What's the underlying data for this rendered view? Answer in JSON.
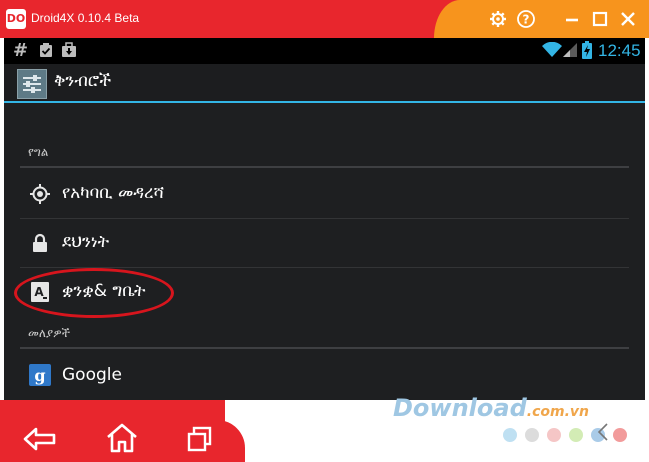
{
  "window": {
    "app_name": "Droid4X 0.10.4 Beta",
    "logo_text": "DO",
    "buttons": [
      "settings-icon",
      "help-icon",
      "minimize-icon",
      "maximize-icon",
      "close-icon"
    ]
  },
  "statusbar": {
    "left_icons": [
      "hash-icon",
      "clipboard-check-icon",
      "bag-download-icon"
    ],
    "right_icons": [
      "wifi-icon",
      "signal-icon",
      "battery-icon"
    ],
    "clock": "12:45"
  },
  "actionbar": {
    "title": "ቅንብሮች"
  },
  "sections": {
    "personal": "የግል",
    "accounts": "መለያዎች"
  },
  "rows": {
    "location": "የአካባቢ መዳረሻ",
    "security": "ደህንነት",
    "language": "ቋንቋ& ግቤት",
    "google": "Google"
  },
  "watermark": {
    "text": "Download",
    "domain": ".com.vn"
  },
  "colors": {
    "titlebar_red": "#e8262d",
    "titlebar_orange": "#f7941d",
    "accent_blue": "#33b5e5",
    "annotation_red": "#d7151d"
  },
  "navbar": [
    "back-icon",
    "home-icon",
    "recent-apps-icon"
  ]
}
